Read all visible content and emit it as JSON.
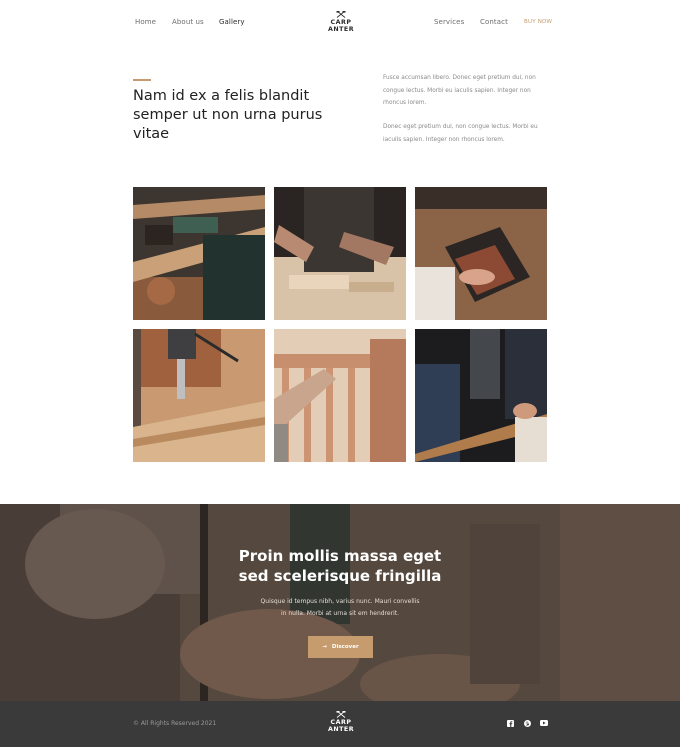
{
  "nav": {
    "links": [
      "Home",
      "About us",
      "Gallery",
      "Services",
      "Contact"
    ],
    "active": "Gallery",
    "buy_label": "BUY NOW",
    "logo_line1": "CARP",
    "logo_line2": "ANTER"
  },
  "intro": {
    "title": "Nam id ex a felis blandit semper ut non urna purus vitae",
    "paragraph1": "Fusce accumsan libero. Donec eget pretium dui, non congue lectus. Morbi eu iaculis sapien. Integer non rhoncus lorem.",
    "paragraph2": "Donec eget pretium dui, non congue lectus. Morbi eu iaculis sapien. Integer non rhoncus lorem."
  },
  "hero": {
    "title": "Proin mollis massa eget sed scelerisque fringilla",
    "subtitle": "Quisque id tempus nibh, varius nunc. Mauri convellis in nulla. Morbi at urna sit em hendrerit.",
    "button_label": "Discover"
  },
  "footer": {
    "copyright": "© All Rights Reserved 2021",
    "logo_line1": "CARP",
    "logo_line2": "ANTER",
    "social": [
      "facebook-icon",
      "pinterest-icon",
      "youtube-icon"
    ]
  },
  "colors": {
    "accent": "#c69b6d",
    "footer_bg": "#3a3a3a",
    "hero_overlay": "#5b4e45"
  }
}
